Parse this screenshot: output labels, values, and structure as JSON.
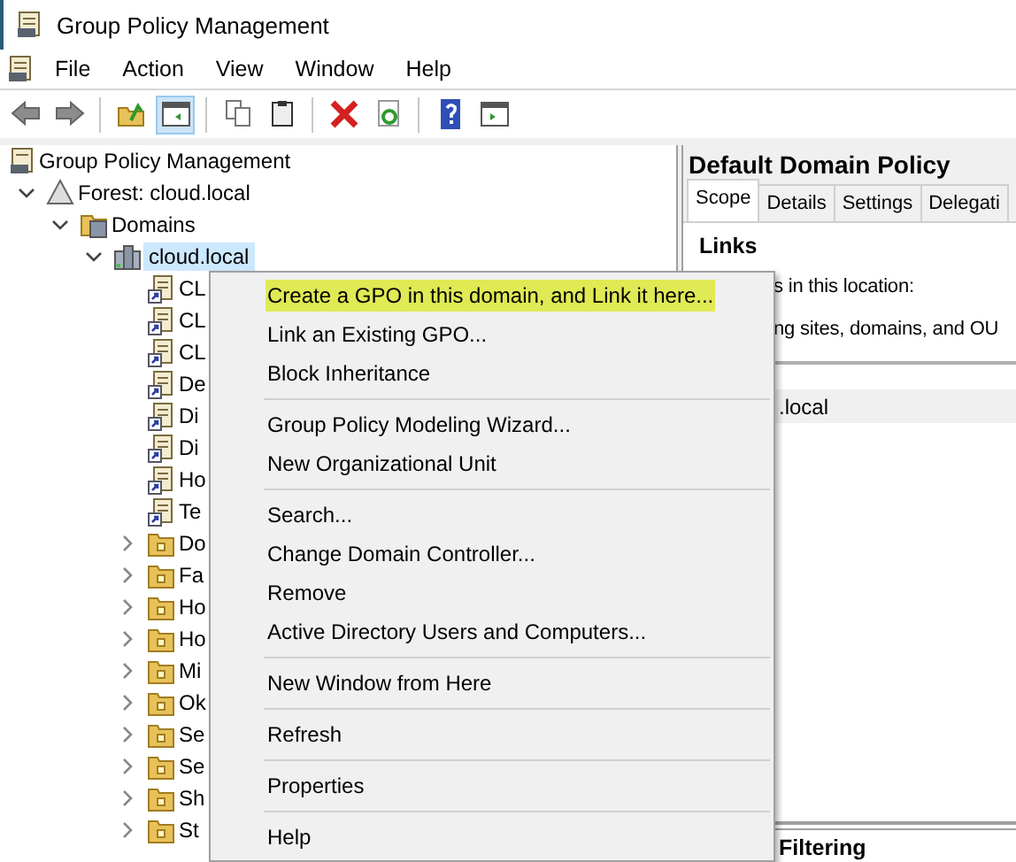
{
  "window": {
    "title": "Group Policy Management"
  },
  "menu_bar": [
    {
      "label": "File"
    },
    {
      "label": "Action"
    },
    {
      "label": "View"
    },
    {
      "label": "Window"
    },
    {
      "label": "Help"
    }
  ],
  "toolbar": [
    {
      "kind": "back",
      "pressed": false
    },
    {
      "kind": "forward",
      "pressed": false
    },
    {
      "kind": "separator"
    },
    {
      "kind": "up",
      "pressed": false
    },
    {
      "kind": "tree_toggle",
      "pressed": true
    },
    {
      "kind": "separator"
    },
    {
      "kind": "copy",
      "pressed": false
    },
    {
      "kind": "paste",
      "pressed": false
    },
    {
      "kind": "separator"
    },
    {
      "kind": "delete",
      "pressed": false
    },
    {
      "kind": "refresh",
      "pressed": false
    },
    {
      "kind": "separator"
    },
    {
      "kind": "help",
      "pressed": false
    },
    {
      "kind": "pane_toggle",
      "pressed": false
    }
  ],
  "tree": [
    {
      "label": "Group Policy Management",
      "kind": "root",
      "selected": false,
      "children": [
        {
          "label": "Forest: cloud.local",
          "kind": "forest",
          "selected": false,
          "expanded": true,
          "children": [
            {
              "label": "Domains",
              "kind": "domains",
              "selected": false,
              "expanded": true,
              "children": [
                {
                  "label": "cloud.local",
                  "kind": "domain",
                  "selected": true,
                  "expanded": true,
                  "children": [
                    {
                      "label": "CL",
                      "kind": "gpo_link",
                      "selected": false
                    },
                    {
                      "label": "CL",
                      "kind": "gpo_link",
                      "selected": false
                    },
                    {
                      "label": "CL",
                      "kind": "gpo_link",
                      "selected": false
                    },
                    {
                      "label": "De",
                      "kind": "gpo_link",
                      "selected": false
                    },
                    {
                      "label": "Di",
                      "kind": "gpo_link",
                      "selected": false
                    },
                    {
                      "label": "Di",
                      "kind": "gpo_link",
                      "selected": false
                    },
                    {
                      "label": "Ho",
                      "kind": "gpo_link",
                      "selected": false
                    },
                    {
                      "label": "Te",
                      "kind": "gpo_link",
                      "selected": false
                    },
                    {
                      "label": "Do",
                      "kind": "ou",
                      "selected": false,
                      "expanded": false
                    },
                    {
                      "label": "Fa",
                      "kind": "ou",
                      "selected": false,
                      "expanded": false
                    },
                    {
                      "label": "Ho",
                      "kind": "ou",
                      "selected": false,
                      "expanded": false
                    },
                    {
                      "label": "Ho",
                      "kind": "ou",
                      "selected": false,
                      "expanded": false
                    },
                    {
                      "label": "Mi",
                      "kind": "ou",
                      "selected": false,
                      "expanded": false
                    },
                    {
                      "label": "Ok",
                      "kind": "ou",
                      "selected": false,
                      "expanded": false
                    },
                    {
                      "label": "Se",
                      "kind": "ou",
                      "selected": false,
                      "expanded": false
                    },
                    {
                      "label": "Se",
                      "kind": "ou",
                      "selected": false,
                      "expanded": false
                    },
                    {
                      "label": "Sh",
                      "kind": "ou",
                      "selected": false,
                      "expanded": false
                    },
                    {
                      "label": "St",
                      "kind": "ou",
                      "selected": false,
                      "expanded": false
                    }
                  ]
                }
              ]
            }
          ]
        }
      ]
    }
  ],
  "details": {
    "title": "Default Domain Policy",
    "tabs": [
      {
        "label": "Scope",
        "selected": true
      },
      {
        "label": "Details",
        "selected": false
      },
      {
        "label": "Settings",
        "selected": false
      },
      {
        "label": "Delegati",
        "selected": false
      }
    ],
    "section": "Links",
    "line_1": "s in this location:",
    "line_2": "ng sites, domains, and OU",
    "row": ".local",
    "footer_section": "Filtering"
  },
  "context_menu": [
    {
      "kind": "item",
      "label": "Create a GPO in this domain, and Link it here...",
      "selected": true
    },
    {
      "kind": "item",
      "label": "Link an Existing GPO...",
      "selected": false
    },
    {
      "kind": "item",
      "label": "Block Inheritance",
      "selected": false
    },
    {
      "kind": "separator"
    },
    {
      "kind": "item",
      "label": "Group Policy Modeling Wizard...",
      "selected": false
    },
    {
      "kind": "item",
      "label": "New Organizational Unit",
      "selected": false
    },
    {
      "kind": "separator"
    },
    {
      "kind": "item",
      "label": "Search...",
      "selected": false
    },
    {
      "kind": "item",
      "label": "Change Domain Controller...",
      "selected": false
    },
    {
      "kind": "item",
      "label": "Remove",
      "selected": false
    },
    {
      "kind": "item",
      "label": "Active Directory Users and Computers...",
      "selected": false
    },
    {
      "kind": "separator"
    },
    {
      "kind": "item",
      "label": "New Window from Here",
      "selected": false
    },
    {
      "kind": "separator"
    },
    {
      "kind": "item",
      "label": "Refresh",
      "selected": false
    },
    {
      "kind": "separator"
    },
    {
      "kind": "item",
      "label": "Properties",
      "selected": false
    },
    {
      "kind": "separator"
    },
    {
      "kind": "item",
      "label": "Help",
      "selected": false
    }
  ]
}
